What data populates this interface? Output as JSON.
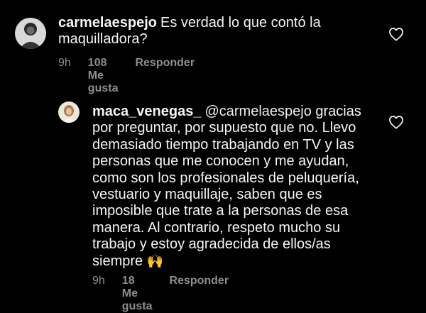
{
  "comments": [
    {
      "username": "carmelaespejo",
      "text": "Es verdad lo que contó la maquilladora?",
      "time": "9h",
      "likes": "108 Me gusta",
      "reply_label": "Responder"
    },
    {
      "username": "maca_venegas_",
      "mention": "@carmelaespejo",
      "text": "gracias por preguntar, por supuesto que no. Llevo demasiado tiempo trabajando en TV y las personas que me conocen y me ayudan, como son los profesionales de peluquería, vestuario y maquillaje, saben que es imposible que trate a la personas de esa manera. Al contrario, respeto mucho su trabajo y estoy agradecida de ellos/as siempre",
      "emoji": "🙌",
      "time": "9h",
      "likes": "18 Me gusta",
      "reply_label": "Responder"
    }
  ]
}
